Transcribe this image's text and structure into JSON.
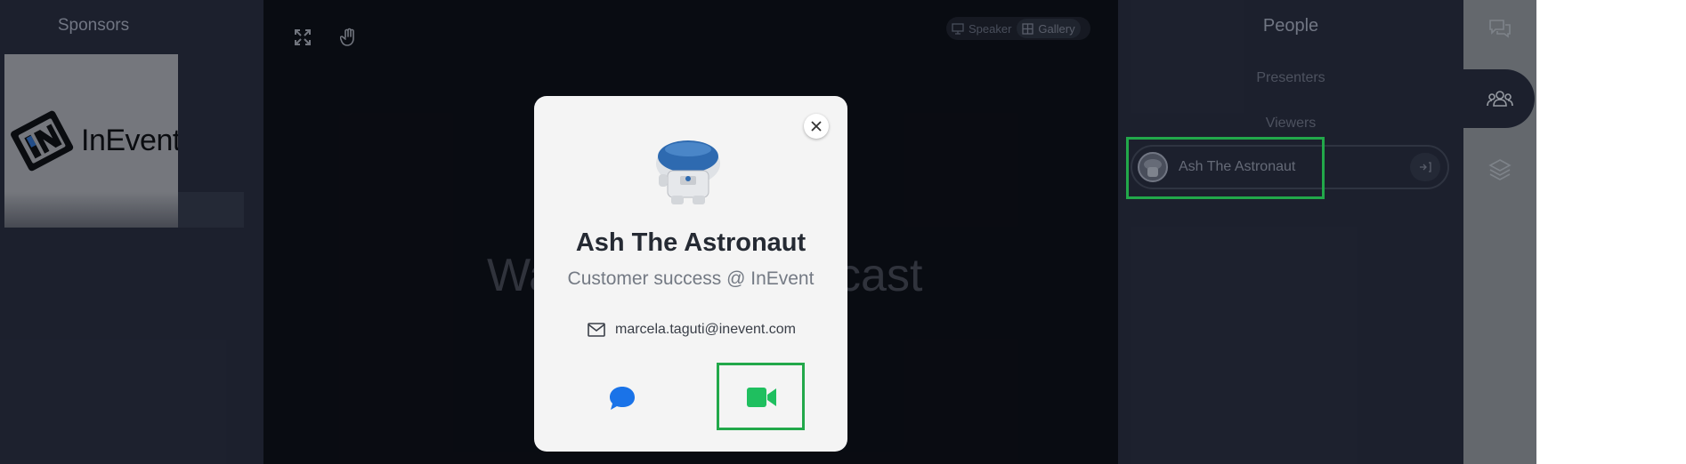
{
  "sponsors": {
    "title": "Sponsors",
    "logo_text": "InEvent",
    "logo_alt": "InEvent logo"
  },
  "stage": {
    "tools": [
      {
        "icon": "fullscreen-icon"
      },
      {
        "icon": "raise-hand-icon"
      }
    ],
    "view_toggle": [
      {
        "label": "Speaker",
        "icon": "speaker-view-icon"
      },
      {
        "label": "Gallery",
        "icon": "gallery-view-icon",
        "active": true
      }
    ],
    "watermark": "Waiting for broadcast"
  },
  "people": {
    "title": "People",
    "presenters_label": "Presenters",
    "viewers_label": "Viewers",
    "viewers": [
      {
        "name": "Ash The Astronaut",
        "action_icon": "enter-icon"
      }
    ]
  },
  "right_rail": [
    {
      "icon": "chat-icon"
    },
    {
      "icon": "people-icon",
      "active": true
    },
    {
      "icon": "layers-icon"
    }
  ],
  "modal": {
    "name": "Ash The Astronaut",
    "role": "Customer success @ InEvent",
    "email": "marcela.taguti@inevent.com",
    "actions": [
      {
        "icon": "chat-bubble-icon",
        "color": "#1a73e8"
      },
      {
        "icon": "video-camera-icon",
        "color": "#1fbf5f"
      }
    ]
  },
  "colors": {
    "highlight": "#22a84a",
    "panel": "#232838",
    "stage": "#0c0f16",
    "rail": "#7a7f86",
    "modal_bg": "#f4f4f4"
  }
}
